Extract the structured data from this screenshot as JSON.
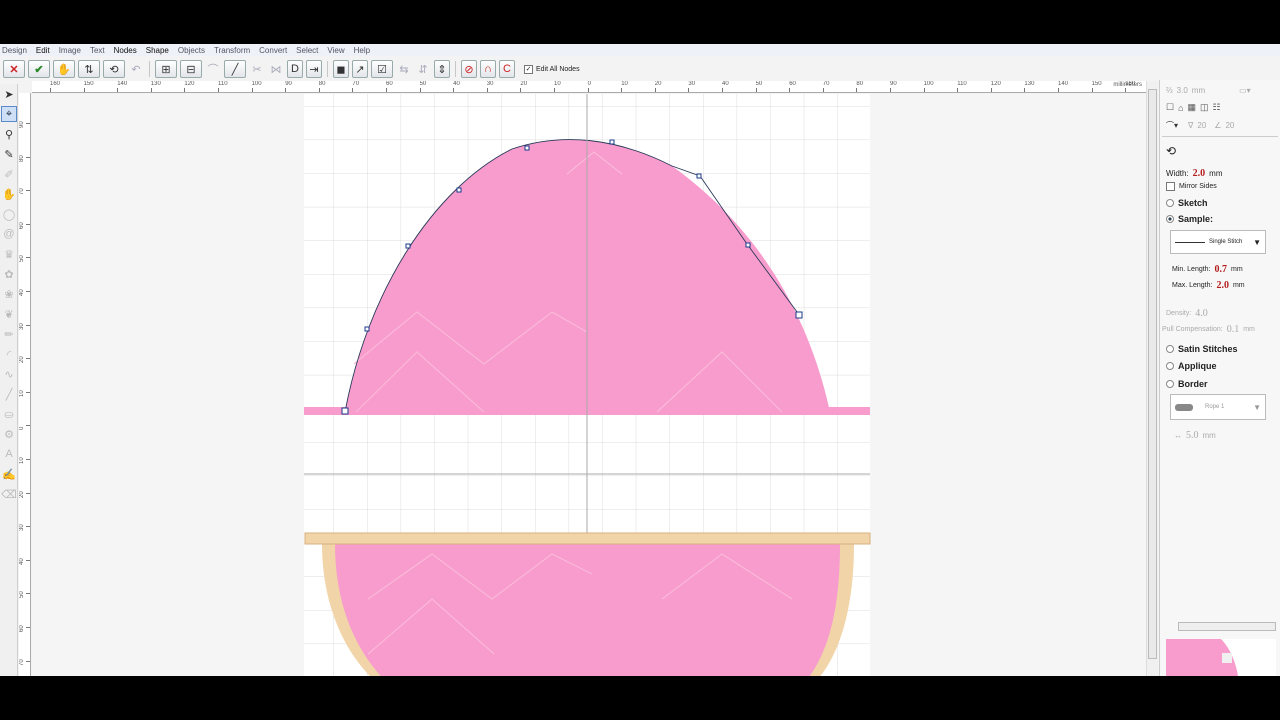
{
  "menu": [
    "Design",
    "Edit",
    "Image",
    "Text",
    "Nodes",
    "Shape",
    "Objects",
    "Transform",
    "Convert",
    "Select",
    "View",
    "Help"
  ],
  "menu_active": [
    "Edit",
    "Nodes",
    "Shape"
  ],
  "toolbar": {
    "cancel_icon": "x-icon",
    "ok_icon": "checkmark-icon",
    "edit_all_nodes_label": "Edit All Nodes",
    "edit_all_nodes_checked": "✓"
  },
  "ruler": {
    "units": "millimeters",
    "h_ticks": [
      "160",
      "150",
      "140",
      "130",
      "120",
      "110",
      "100",
      "90",
      "80",
      "70",
      "60",
      "50",
      "40",
      "30",
      "20",
      "10",
      "0",
      "10",
      "20",
      "30",
      "40",
      "50",
      "60",
      "70",
      "80",
      "90",
      "100",
      "110",
      "120",
      "130",
      "140",
      "150",
      "160"
    ],
    "v_ticks": [
      "90",
      "80",
      "70",
      "60",
      "50",
      "40",
      "30",
      "20",
      "10",
      "0",
      "10",
      "20",
      "30",
      "40",
      "50",
      "60",
      "70"
    ]
  },
  "right_panel": {
    "top_size": "3.0",
    "top_size_unit": "mm",
    "angle1": "20",
    "angle2": "20",
    "width_label": "Width:",
    "width_value": "2.0",
    "width_unit": "mm",
    "mirror_sides": "Mirror Sides",
    "sketch": "Sketch",
    "sample": "Sample:",
    "sample_type": "Single Stitch",
    "min_length_label": "Min. Length:",
    "min_length_value": "0.7",
    "max_length_label": "Max. Length:",
    "max_length_value": "2.0",
    "mm": "mm",
    "density_label": "Density:",
    "density_value": "4.0",
    "pull_comp_label": "Pull Compensation:",
    "pull_comp_value": "0.1",
    "satin": "Satin Stitches",
    "applique": "Applique",
    "border": "Border",
    "border_type": "Rope 1",
    "border_width": "5.0",
    "border_width_unit": "mm"
  },
  "colors": {
    "fill_pink": "#f79ccc",
    "border_tan": "#f1d5a9",
    "node_blue": "#1a3a8a"
  }
}
